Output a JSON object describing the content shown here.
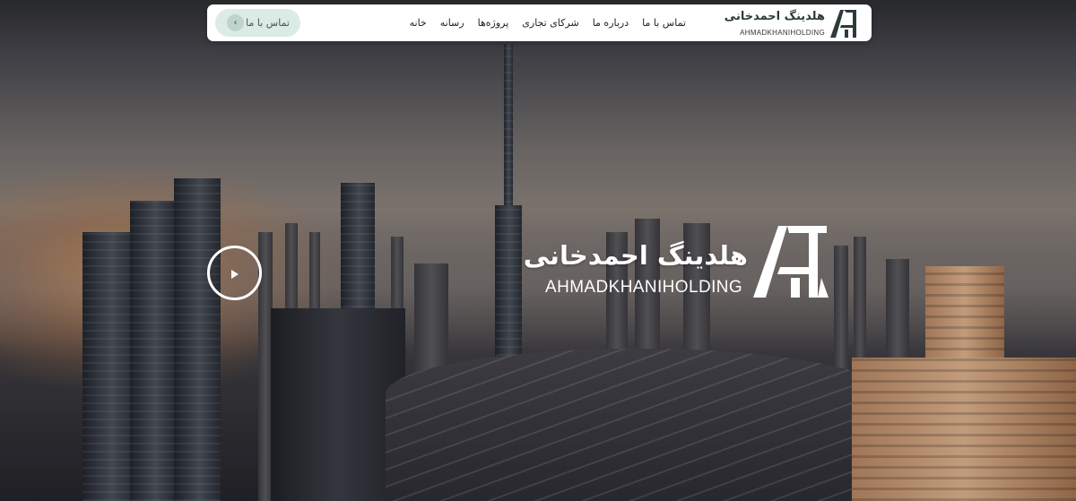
{
  "navbar": {
    "brand": {
      "name": "هلدینگ احمدخانی",
      "latin": "AHMADKHANIHOLDING"
    },
    "menu": [
      {
        "label": "خانه"
      },
      {
        "label": "رسانه"
      },
      {
        "label": "پروژه‌ها"
      },
      {
        "label": "شرکای تجاری"
      },
      {
        "label": "درباره ما"
      },
      {
        "label": "تماس با ما"
      }
    ],
    "contact_button": {
      "label": "تماس با ما",
      "icon": "chevron-left-icon"
    }
  },
  "hero": {
    "brand_name": "هلدینگ احمدخانی",
    "brand_latin": "AHMADKHANIHOLDING",
    "play_icon": "play-icon"
  },
  "colors": {
    "brand_dark": "#2d3a3a",
    "button_bg": "#dcebe6",
    "white": "#ffffff"
  }
}
